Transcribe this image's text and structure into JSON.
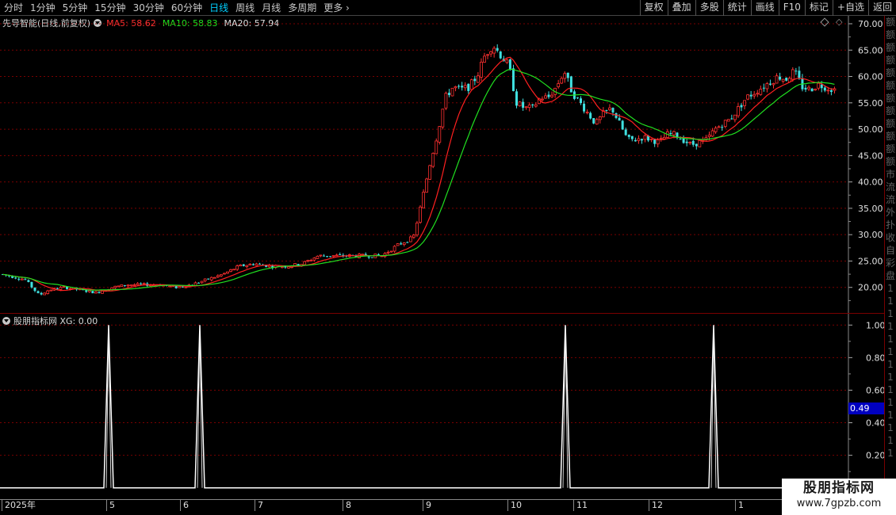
{
  "toolbar": {
    "periods": [
      "分时",
      "1分钟",
      "5分钟",
      "15分钟",
      "30分钟",
      "60分钟",
      "日线",
      "周线",
      "月线",
      "多周期",
      "更多"
    ],
    "active_period": "日线",
    "tools": [
      "复权",
      "叠加",
      "多股",
      "统计",
      "画线",
      "F10",
      "标记",
      "+自选",
      "返回"
    ]
  },
  "main_chart": {
    "stock_name": "先导智能(日线,前复权)",
    "ma5_label": "MA5: 58.62",
    "ma10_label": "MA10: 58.83",
    "ma20_label": "MA20: 57.94",
    "colors": {
      "up": "#ff3030",
      "down": "#40e0e0",
      "ma5": "#ff2020",
      "ma10": "#20e020",
      "grid": "#7a0000",
      "axis_text": "#e0e0e0"
    }
  },
  "sub_chart": {
    "legend": "股朋指标网 XG: 0.00",
    "current_value": "0.49",
    "color": "#ffffff"
  },
  "right_panel_glyphs": [
    "额",
    "额",
    "额",
    "额",
    "额",
    "额",
    "额",
    "额",
    "额",
    "额",
    "额",
    "额",
    "市",
    "流",
    "流",
    "外",
    "扑",
    "收",
    "自",
    "彩",
    "盘",
    "1",
    "1",
    "1",
    "1",
    "1",
    "1",
    "1",
    "1",
    "1",
    "1",
    "1",
    "1",
    "1",
    "1"
  ],
  "date_axis": {
    "labels": [
      "2025年",
      "5",
      "6",
      "7",
      "8",
      "9",
      "10",
      "11",
      "12",
      "1"
    ]
  },
  "watermark": {
    "title": "股朋指标网",
    "url": "www.7gpzb.com"
  },
  "chart_data": [
    {
      "type": "candlestick",
      "title": "先导智能(日线,前复权)",
      "y_ticks": [
        20.0,
        25.0,
        30.0,
        35.0,
        40.0,
        45.0,
        50.0,
        55.0,
        60.0,
        65.0,
        70.0
      ],
      "ylim": [
        15.0,
        71.5
      ],
      "x_labels": [
        "2025年",
        "5",
        "6",
        "7",
        "8",
        "9",
        "10",
        "11",
        "12",
        "1"
      ],
      "series": [
        {
          "name": "MA5",
          "last_value": 58.62
        },
        {
          "name": "MA10",
          "last_value": 58.83
        },
        {
          "name": "MA20",
          "last_value": 57.94
        }
      ],
      "close_trend": [
        [
          0,
          22.5
        ],
        [
          15,
          22.0
        ],
        [
          30,
          21.5
        ],
        [
          48,
          18.5
        ],
        [
          60,
          19.5
        ],
        [
          80,
          20.0
        ],
        [
          100,
          19.5
        ],
        [
          120,
          19.0
        ],
        [
          140,
          20.0
        ],
        [
          160,
          20.5
        ],
        [
          180,
          20.5
        ],
        [
          200,
          20.5
        ],
        [
          220,
          20.0
        ],
        [
          240,
          20.5
        ],
        [
          260,
          21.5
        ],
        [
          280,
          22.5
        ],
        [
          300,
          24.0
        ],
        [
          320,
          24.5
        ],
        [
          340,
          24.0
        ],
        [
          360,
          24.0
        ],
        [
          380,
          24.5
        ],
        [
          400,
          26.0
        ],
        [
          420,
          26.0
        ],
        [
          440,
          26.0
        ],
        [
          460,
          26.0
        ],
        [
          480,
          26.0
        ],
        [
          500,
          28.0
        ],
        [
          520,
          29.5
        ],
        [
          530,
          36.0
        ],
        [
          540,
          43.0
        ],
        [
          550,
          49.0
        ],
        [
          560,
          56.0
        ],
        [
          570,
          58.0
        ],
        [
          580,
          57.5
        ],
        [
          590,
          58.0
        ],
        [
          600,
          60.0
        ],
        [
          610,
          64.0
        ],
        [
          620,
          66.0
        ],
        [
          630,
          64.0
        ],
        [
          640,
          62.0
        ],
        [
          650,
          55.0
        ],
        [
          660,
          54.0
        ],
        [
          670,
          54.0
        ],
        [
          680,
          56.0
        ],
        [
          690,
          56.0
        ],
        [
          700,
          58.0
        ],
        [
          710,
          61.0
        ],
        [
          720,
          57.0
        ],
        [
          730,
          55.0
        ],
        [
          740,
          53.0
        ],
        [
          750,
          51.0
        ],
        [
          760,
          53.0
        ],
        [
          770,
          54.0
        ],
        [
          780,
          51.0
        ],
        [
          790,
          48.0
        ],
        [
          800,
          48.0
        ],
        [
          810,
          48.5
        ],
        [
          820,
          48.0
        ],
        [
          830,
          47.5
        ],
        [
          840,
          49.0
        ],
        [
          850,
          49.0
        ],
        [
          860,
          48.0
        ],
        [
          870,
          47.0
        ],
        [
          880,
          47.5
        ],
        [
          890,
          48.0
        ],
        [
          900,
          50.0
        ],
        [
          910,
          51.0
        ],
        [
          920,
          52.0
        ],
        [
          930,
          54.0
        ],
        [
          940,
          56.0
        ],
        [
          950,
          57.0
        ],
        [
          960,
          58.0
        ],
        [
          970,
          59.0
        ],
        [
          980,
          60.0
        ],
        [
          990,
          59.5
        ],
        [
          1000,
          61.0
        ],
        [
          1010,
          58.0
        ],
        [
          1020,
          57.5
        ],
        [
          1030,
          58.5
        ],
        [
          1040,
          58.0
        ],
        [
          1050,
          57.5
        ]
      ]
    },
    {
      "type": "line",
      "title": "股朋指标网 XG",
      "y_ticks": [
        0.2,
        0.4,
        0.6,
        0.8,
        1.0
      ],
      "ylim": [
        -0.05,
        1.05
      ],
      "x": [
        0,
        131,
        137,
        143,
        246,
        252,
        258,
        707,
        713,
        719,
        894,
        900,
        906,
        1070
      ],
      "values": [
        0,
        0,
        1,
        0,
        0,
        1,
        0,
        0,
        1,
        0,
        0,
        1,
        0,
        0
      ]
    }
  ]
}
